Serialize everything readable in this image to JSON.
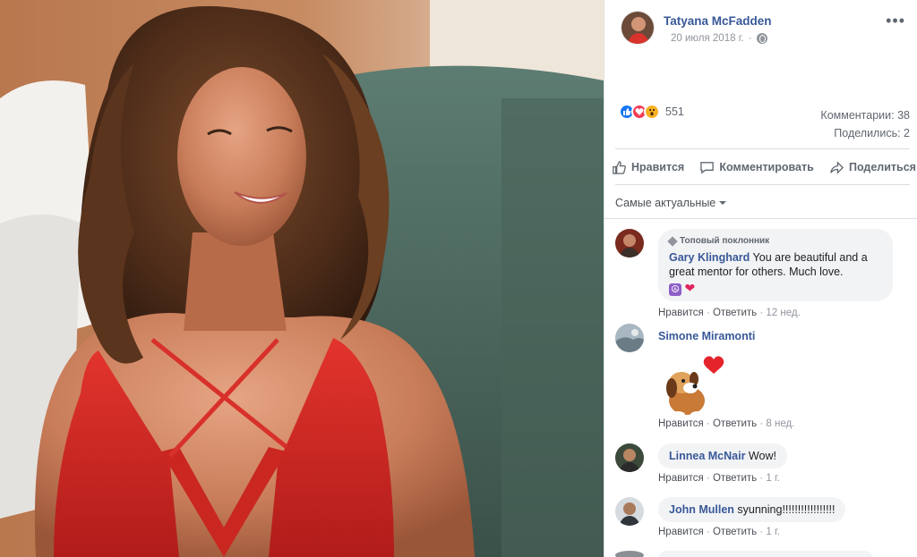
{
  "post": {
    "author": "Tatyana McFadden",
    "date": "20 июля 2018 г.",
    "privacy_icon": "globe-icon",
    "more_icon": "more-options-icon"
  },
  "reactions": {
    "icons": [
      "like-icon",
      "love-icon",
      "wow-icon"
    ],
    "count": "551"
  },
  "stats": {
    "comments": "Комментарии: 38",
    "shares": "Поделились: 2"
  },
  "actions": {
    "like": "Нравится",
    "comment": "Комментировать",
    "share": "Поделиться"
  },
  "sort": {
    "label": "Самые актуальные"
  },
  "comments": [
    {
      "badge": "Топовый поклонник",
      "name": "Gary Klinghard",
      "text": "You are beautiful and a great mentor for others. Much love.",
      "emojis": [
        "peace-emoji",
        "heart-emoji"
      ],
      "like": "Нравится",
      "reply": "Ответить",
      "time": "12 нед."
    },
    {
      "name": "Simone Miramonti",
      "sticker": "dog-heart-sticker",
      "like": "Нравится",
      "reply": "Ответить",
      "time": "8 нед."
    },
    {
      "name": "Linnea McNair",
      "text": "Wow!",
      "like": "Нравится",
      "reply": "Ответить",
      "time": "1 г."
    },
    {
      "name": "John Mullen",
      "text": "syunning!!!!!!!!!!!!!!!!!",
      "like": "Нравится",
      "reply": "Ответить",
      "time": "1 г."
    }
  ],
  "colors": {
    "link": "#385898",
    "muted": "#90949c",
    "bubble": "#f2f3f5",
    "like_blue": "#1877f2",
    "love_red": "#f33e58",
    "wow_yellow": "#f7b125"
  }
}
